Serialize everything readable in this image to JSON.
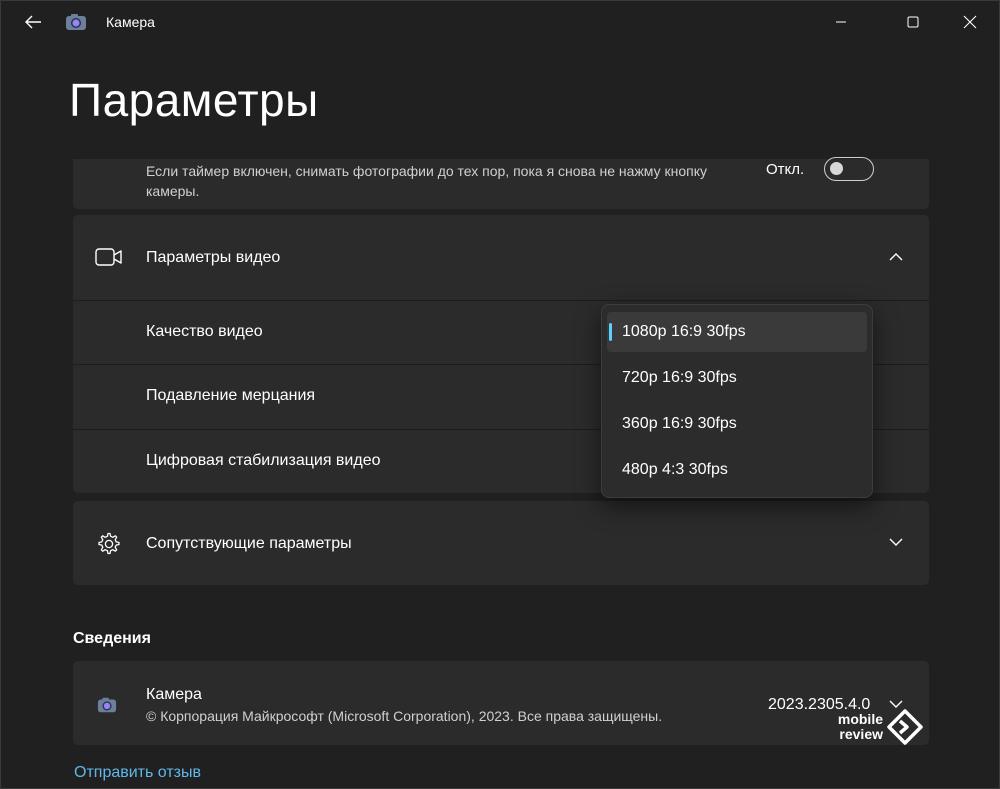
{
  "app": {
    "window_title": "Камера",
    "page_title": "Параметры"
  },
  "timer_card": {
    "description": "Если таймер включен, снимать фотографии до тех пор, пока я снова не нажму кнопку камеры.",
    "state": "Откл.",
    "enabled": false
  },
  "video_settings": {
    "header": "Параметры видео",
    "expanded": true,
    "rows": [
      {
        "label": "Качество видео"
      },
      {
        "label": "Подавление мерцания"
      },
      {
        "label": "Цифровая стабилизация видео"
      }
    ]
  },
  "video_quality_dropdown": {
    "options": [
      "1080p 16:9 30fps",
      "720p 16:9 30fps",
      "360p 16:9 30fps",
      "480p 4:3 30fps"
    ],
    "selected": "1080p 16:9 30fps"
  },
  "related_settings": {
    "header": "Сопутствующие параметры",
    "expanded": false
  },
  "about": {
    "section_title": "Сведения",
    "app_name": "Камера",
    "copyright": "© Корпорация Майкрософт (Microsoft Corporation), 2023. Все права защищены.",
    "version": "2023.2305.4.0"
  },
  "feedback_link": "Отправить отзыв",
  "watermark": {
    "line1": "mobile",
    "line2": "review"
  },
  "colors": {
    "background": "#202020",
    "card": "#2b2b2b",
    "accent": "#60cdff",
    "link": "#60b8ea"
  },
  "icons": {
    "back": "back-arrow-icon",
    "app": "camera-app-icon",
    "video": "video-camera-icon",
    "related": "gear-icon",
    "expand": "chevron-up-icon",
    "collapse": "chevron-down-icon"
  }
}
